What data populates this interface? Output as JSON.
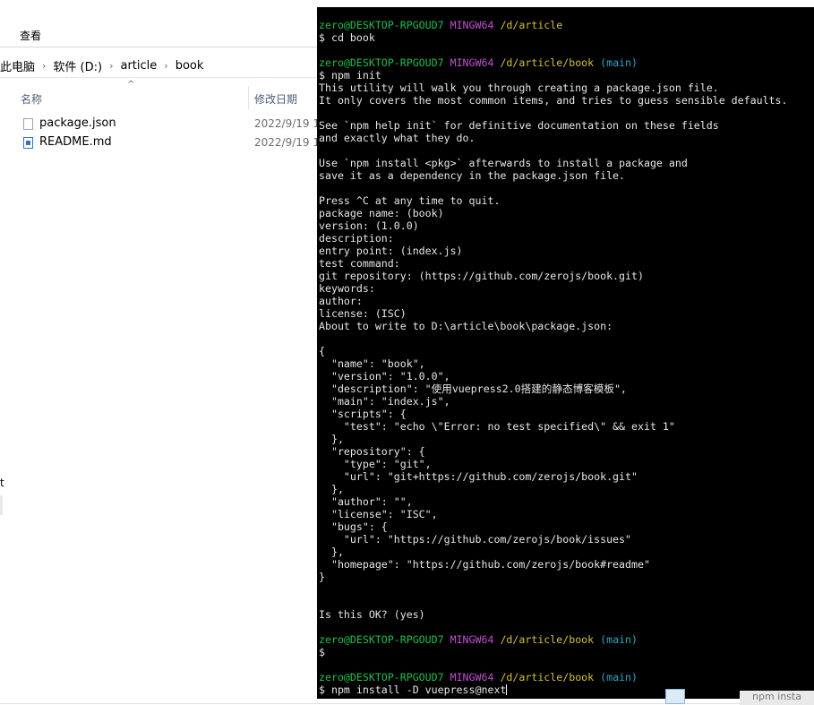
{
  "explorer": {
    "ribbon_tab": "查看",
    "breadcrumb": [
      "此电脑",
      "软件 (D:)",
      "article",
      "book"
    ],
    "sort_indicator": "^",
    "columns": {
      "name": "名称",
      "date": "修改日期"
    },
    "files": [
      {
        "name": "package.json",
        "date": "2022/9/19 1",
        "icon": "json-file-icon"
      },
      {
        "name": "README.md",
        "date": "2022/9/19 1",
        "icon": "markdown-file-icon"
      }
    ],
    "edge_mark": "t"
  },
  "terminal": {
    "colors": {
      "user": "#1fbf4f",
      "system": "#c24fd1",
      "path": "#d4c03a",
      "branch": "#2aa7c9",
      "text": "#e6e6e6",
      "background": "#000000"
    },
    "lines": [
      [
        [
          "user",
          "zero@DESKTOP-RPGOUD7 "
        ],
        [
          "sys",
          "MINGW64 "
        ],
        [
          "path",
          "/d/article"
        ]
      ],
      [
        [
          "txt",
          "$ cd book"
        ]
      ],
      [],
      [
        [
          "user",
          "zero@DESKTOP-RPGOUD7 "
        ],
        [
          "sys",
          "MINGW64 "
        ],
        [
          "path",
          "/d/article/book "
        ],
        [
          "br",
          "(main)"
        ]
      ],
      [
        [
          "txt",
          "$ npm init"
        ]
      ],
      [
        [
          "txt",
          "This utility will walk you through creating a package.json file."
        ]
      ],
      [
        [
          "txt",
          "It only covers the most common items, and tries to guess sensible defaults."
        ]
      ],
      [],
      [
        [
          "txt",
          "See `npm help init` for definitive documentation on these fields"
        ]
      ],
      [
        [
          "txt",
          "and exactly what they do."
        ]
      ],
      [],
      [
        [
          "txt",
          "Use `npm install <pkg>` afterwards to install a package and"
        ]
      ],
      [
        [
          "txt",
          "save it as a dependency in the package.json file."
        ]
      ],
      [],
      [
        [
          "txt",
          "Press ^C at any time to quit."
        ]
      ],
      [
        [
          "txt",
          "package name: (book)"
        ]
      ],
      [
        [
          "txt",
          "version: (1.0.0)"
        ]
      ],
      [
        [
          "txt",
          "description:"
        ]
      ],
      [
        [
          "txt",
          "entry point: (index.js)"
        ]
      ],
      [
        [
          "txt",
          "test command:"
        ]
      ],
      [
        [
          "txt",
          "git repository: (https://github.com/zerojs/book.git)"
        ]
      ],
      [
        [
          "txt",
          "keywords:"
        ]
      ],
      [
        [
          "txt",
          "author:"
        ]
      ],
      [
        [
          "txt",
          "license: (ISC)"
        ]
      ],
      [
        [
          "txt",
          "About to write to D:\\article\\book\\package.json:"
        ]
      ],
      [],
      [
        [
          "txt",
          "{"
        ]
      ],
      [
        [
          "txt",
          "  \"name\": \"book\","
        ]
      ],
      [
        [
          "txt",
          "  \"version\": \"1.0.0\","
        ]
      ],
      [
        [
          "txt",
          "  \"description\": \"使用vuepress2.0搭建的静态博客模板\","
        ]
      ],
      [
        [
          "txt",
          "  \"main\": \"index.js\","
        ]
      ],
      [
        [
          "txt",
          "  \"scripts\": {"
        ]
      ],
      [
        [
          "txt",
          "    \"test\": \"echo \\\"Error: no test specified\\\" && exit 1\""
        ]
      ],
      [
        [
          "txt",
          "  },"
        ]
      ],
      [
        [
          "txt",
          "  \"repository\": {"
        ]
      ],
      [
        [
          "txt",
          "    \"type\": \"git\","
        ]
      ],
      [
        [
          "txt",
          "    \"url\": \"git+https://github.com/zerojs/book.git\""
        ]
      ],
      [
        [
          "txt",
          "  },"
        ]
      ],
      [
        [
          "txt",
          "  \"author\": \"\","
        ]
      ],
      [
        [
          "txt",
          "  \"license\": \"ISC\","
        ]
      ],
      [
        [
          "txt",
          "  \"bugs\": {"
        ]
      ],
      [
        [
          "txt",
          "    \"url\": \"https://github.com/zerojs/book/issues\""
        ]
      ],
      [
        [
          "txt",
          "  },"
        ]
      ],
      [
        [
          "txt",
          "  \"homepage\": \"https://github.com/zerojs/book#readme\""
        ]
      ],
      [
        [
          "txt",
          "}"
        ]
      ],
      [],
      [],
      [
        [
          "txt",
          "Is this OK? (yes)"
        ]
      ],
      [],
      [
        [
          "user",
          "zero@DESKTOP-RPGOUD7 "
        ],
        [
          "sys",
          "MINGW64 "
        ],
        [
          "path",
          "/d/article/book "
        ],
        [
          "br",
          "(main)"
        ]
      ],
      [
        [
          "txt",
          "$"
        ]
      ],
      [],
      [
        [
          "user",
          "zero@DESKTOP-RPGOUD7 "
        ],
        [
          "sys",
          "MINGW64 "
        ],
        [
          "path",
          "/d/article/book "
        ],
        [
          "br",
          "(main)"
        ]
      ],
      [
        [
          "txt",
          "$ npm install -D vuepress@next"
        ]
      ]
    ]
  },
  "taskbar": {
    "hint": "npm insta"
  }
}
